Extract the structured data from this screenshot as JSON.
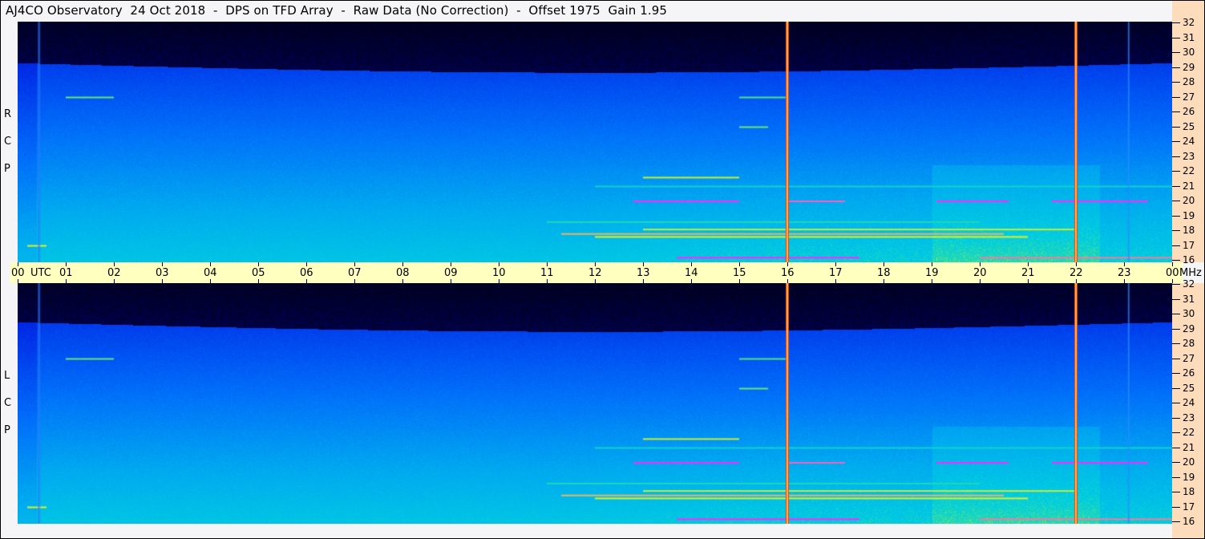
{
  "title": "AJ4CO Observatory  24 Oct 2018  -  DPS on TFD Array  -  Raw Data (No Correction)  -  Offset 1975  Gain 1.95",
  "chart_data": {
    "type": "heatmap",
    "title": "AJ4CO Observatory  24 Oct 2018  -  DPS on TFD Array  -  Raw Data (No Correction)  -  Offset 1975  Gain 1.95",
    "xlabel": "UTC",
    "ylabel": "MHz",
    "xlim": [
      0,
      24
    ],
    "ylim": [
      16,
      32
    ],
    "x_ticks": [
      "00",
      "01",
      "02",
      "03",
      "04",
      "05",
      "06",
      "07",
      "08",
      "09",
      "10",
      "11",
      "12",
      "13",
      "14",
      "15",
      "16",
      "17",
      "18",
      "19",
      "20",
      "21",
      "22",
      "23",
      "00"
    ],
    "x_first_suffix": "UTC",
    "x_last_suffix": "MHz",
    "y_ticks": [
      32,
      31,
      30,
      29,
      28,
      27,
      26,
      25,
      24,
      23,
      22,
      21,
      20,
      19,
      18,
      17,
      16
    ],
    "panels": [
      {
        "name": "RCP",
        "label": [
          "R",
          "C",
          "P"
        ]
      },
      {
        "name": "LCP",
        "label": [
          "L",
          "C",
          "P"
        ]
      }
    ],
    "vertical_markers_utc": [
      16,
      22
    ],
    "colors": {
      "marker_outer": "#ff2060",
      "marker_inner": "#ffd000",
      "axis_bg": "#ffffc0",
      "freq_bg": "#fddcbc"
    }
  }
}
